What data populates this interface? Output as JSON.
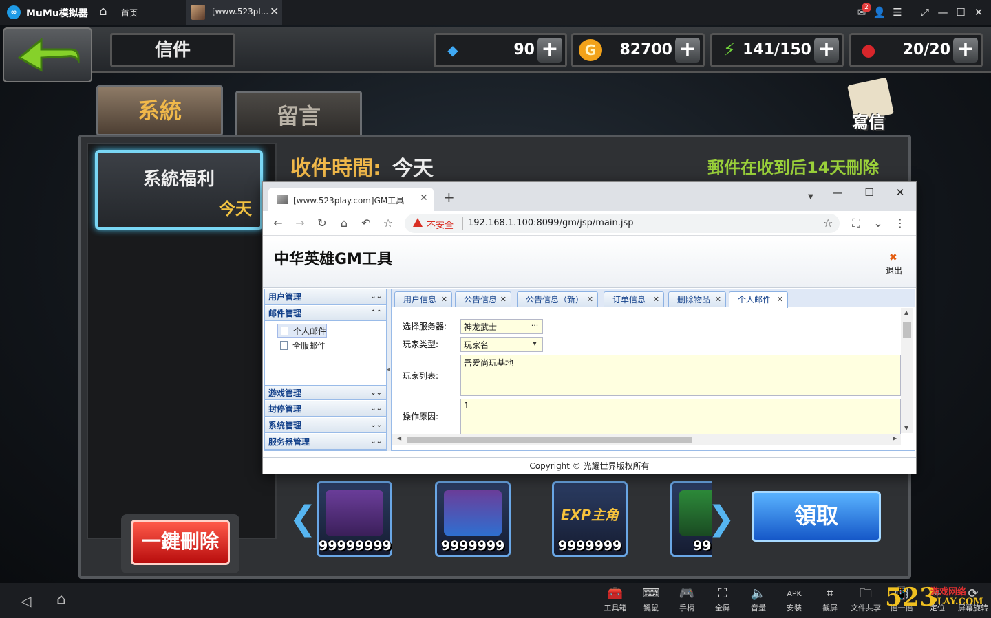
{
  "emulator": {
    "app_name": "MuMu模拟器",
    "home_tab_label": "首页",
    "active_tab_title": "[www.523pl...",
    "mail_badge_count": "2",
    "toolbar": [
      {
        "label": "工具箱",
        "icon": "toolbox-icon"
      },
      {
        "label": "键鼠",
        "icon": "keyboard-icon"
      },
      {
        "label": "手柄",
        "icon": "gamepad-icon"
      },
      {
        "label": "全屏",
        "icon": "fullscreen-icon"
      },
      {
        "label": "音量",
        "icon": "volume-icon"
      },
      {
        "label": "安装",
        "icon": "apk-install-icon"
      },
      {
        "label": "截屏",
        "icon": "screenshot-icon"
      },
      {
        "label": "文件共享",
        "icon": "folder-icon"
      },
      {
        "label": "摇一摇",
        "icon": "shake-icon"
      },
      {
        "label": "定位",
        "icon": "location-icon"
      },
      {
        "label": "屏幕旋转",
        "icon": "rotate-icon"
      }
    ]
  },
  "watermark": {
    "num": "523",
    "cn": "游戏网络",
    "url": "PLAY.COM"
  },
  "game": {
    "title": "信件",
    "resources": [
      {
        "icon": "diamond-icon",
        "value": "90",
        "color": "#3fa9f5"
      },
      {
        "icon": "gold-coin-icon",
        "value": "82700",
        "color": "#f2a21a"
      },
      {
        "icon": "energy-icon",
        "value": "141/150",
        "color": "#6fd13a"
      },
      {
        "icon": "stamina-icon",
        "value": "20/20",
        "color": "#d8262b"
      }
    ],
    "tabs": {
      "system": "系統",
      "message": "留言"
    },
    "write_label": "寫信",
    "mail_item": {
      "title": "系統福利",
      "date": "今天"
    },
    "received_label": "收件時間:",
    "received_value": "今天",
    "delete_note": "郵件在收到后14天刪除",
    "delete_all_label": "一鍵刪除",
    "claim_label": "領取",
    "rewards": [
      {
        "count": "99999999",
        "kind": "gold-chest-icon"
      },
      {
        "count": "9999999",
        "kind": "diamond-chest-icon"
      },
      {
        "count": "9999999",
        "kind": "exp-icon",
        "text": "EXP主角"
      },
      {
        "count": "99",
        "kind": "green-item-icon"
      }
    ]
  },
  "browser": {
    "tab_title": "[www.523play.com]GM工具",
    "insecure_label": "不安全",
    "url": "192.168.1.100:8099/gm/jsp/main.jsp",
    "page": {
      "title": "中华英雄GM工具",
      "logout_label": "退出",
      "sidebar": [
        {
          "label": "用户管理",
          "expanded": false
        },
        {
          "label": "邮件管理",
          "expanded": true,
          "children": [
            "个人邮件",
            "全服邮件"
          ]
        },
        {
          "label": "游戏管理",
          "expanded": false
        },
        {
          "label": "封停管理",
          "expanded": false
        },
        {
          "label": "系统管理",
          "expanded": false
        },
        {
          "label": "服务器管理",
          "expanded": false
        }
      ],
      "tabs": [
        "用户信息",
        "公告信息",
        "公告信息（新）",
        "订单信息",
        "删除物品",
        "个人邮件"
      ],
      "active_tab": "个人邮件",
      "form": {
        "server_label": "选择服务器:",
        "server_value": "神龙武士",
        "player_type_label": "玩家类型:",
        "player_type_value": "玩家名",
        "player_list_label": "玩家列表:",
        "player_list_value": "吾爱尚玩基地",
        "reason_label": "操作原因:",
        "reason_value": "1"
      },
      "footer": "Copyright © 光耀世界版权所有"
    }
  }
}
